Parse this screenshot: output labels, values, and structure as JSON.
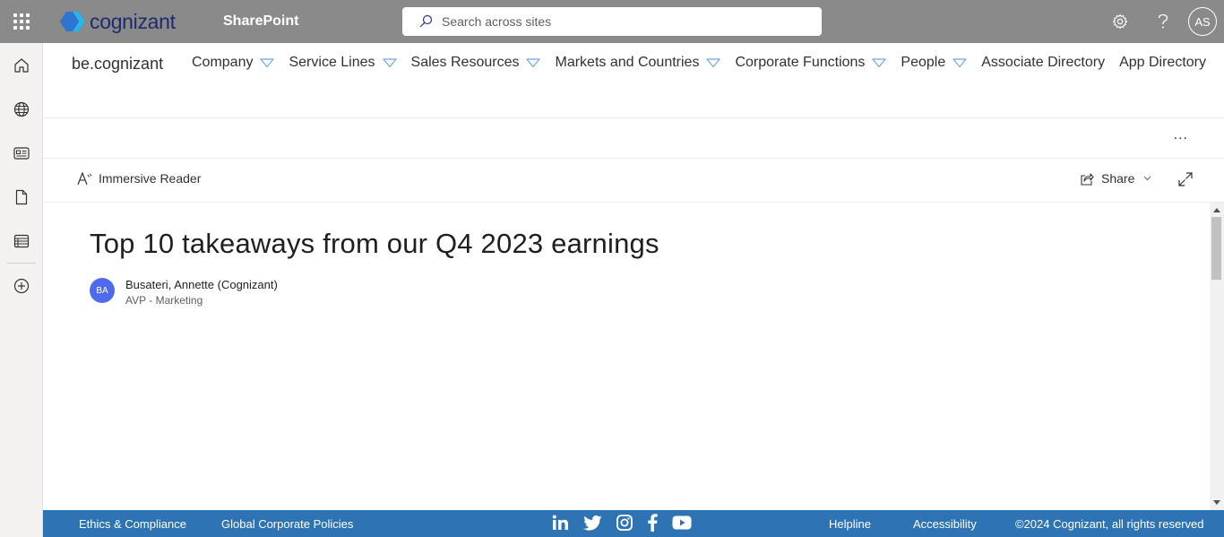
{
  "suitebar": {
    "brand": "cognizant",
    "app_name": "SharePoint",
    "search_placeholder": "Search across sites",
    "avatar_initials": "AS"
  },
  "site": {
    "title": "be.cognizant",
    "nav": [
      {
        "label": "Company",
        "has_dropdown": true
      },
      {
        "label": "Service Lines",
        "has_dropdown": true
      },
      {
        "label": "Sales Resources",
        "has_dropdown": true
      },
      {
        "label": "Markets and Countries",
        "has_dropdown": true
      },
      {
        "label": "Corporate Functions",
        "has_dropdown": true
      },
      {
        "label": "People",
        "has_dropdown": true
      },
      {
        "label": "Associate Directory",
        "has_dropdown": false
      },
      {
        "label": "App Directory",
        "has_dropdown": false
      }
    ]
  },
  "commandbar": {
    "more": "...",
    "immersive_reader": "Immersive Reader",
    "share": "Share"
  },
  "article": {
    "title": "Top 10 takeaways from our Q4 2023 earnings",
    "author_initials": "BA",
    "author_name": "Busateri, Annette (Cognizant)",
    "author_role": "AVP - Marketing"
  },
  "footer": {
    "ethics": "Ethics & Compliance",
    "policies": "Global Corporate Policies",
    "helpline": "Helpline",
    "accessibility": "Accessibility",
    "copyright": "©2024 Cognizant, all rights reserved",
    "social": [
      "linkedin-icon",
      "twitter-icon",
      "instagram-icon",
      "facebook-icon",
      "youtube-icon"
    ]
  },
  "colors": {
    "suitebar": "#8a8a8a",
    "footer": "#2e74b5",
    "avatar": "#4f6bed",
    "brand_text": "#1f2a6e"
  }
}
